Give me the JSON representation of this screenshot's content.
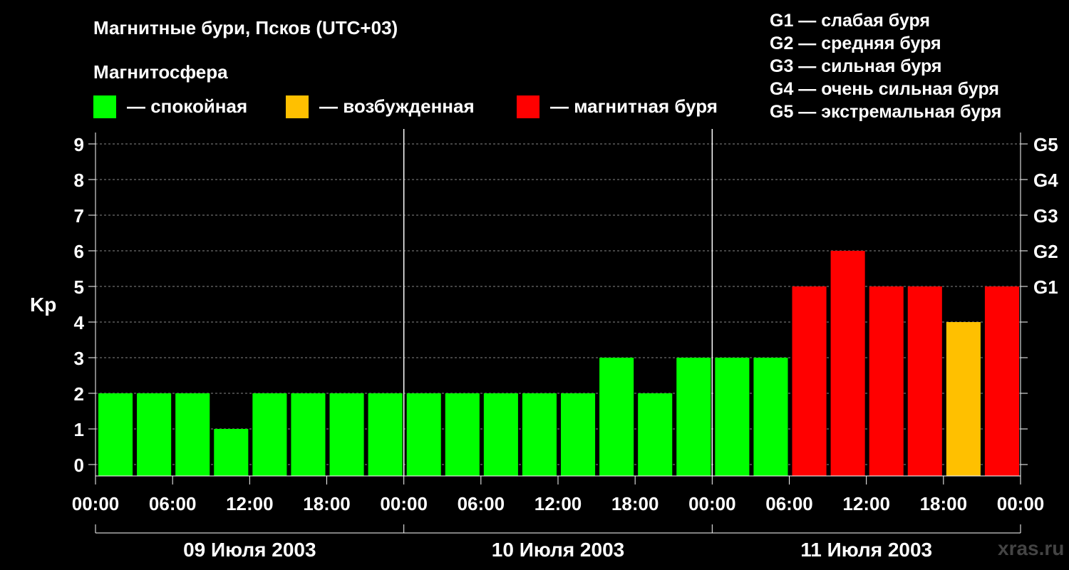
{
  "header": {
    "title": "Магнитные бури, Псков (UTC+03)",
    "subtitle": "Магнитосфера"
  },
  "legend": {
    "items": [
      {
        "label": "— спокойная",
        "color": "#00ff00"
      },
      {
        "label": "— возбужденная",
        "color": "#ffc000"
      },
      {
        "label": "— магнитная буря",
        "color": "#ff0000"
      }
    ]
  },
  "g_levels": [
    "G1 — слабая буря",
    "G2 — средняя буря",
    "G3 — сильная буря",
    "G4 — очень сильная буря",
    "G5 — экстремальная буря"
  ],
  "watermark": "xras.ru",
  "chart_data": {
    "type": "bar",
    "ylabel": "Kp",
    "ylim": [
      0,
      9
    ],
    "y_ticks": [
      "0",
      "1",
      "2",
      "3",
      "4",
      "5",
      "6",
      "7",
      "8",
      "9"
    ],
    "right_ticks": [
      {
        "value": 5,
        "label": "G1"
      },
      {
        "value": 6,
        "label": "G2"
      },
      {
        "value": 7,
        "label": "G3"
      },
      {
        "value": 8,
        "label": "G4"
      },
      {
        "value": 9,
        "label": "G5"
      }
    ],
    "x_tick_labels": [
      "00:00",
      "06:00",
      "12:00",
      "18:00",
      "00:00",
      "06:00",
      "12:00",
      "18:00",
      "00:00",
      "06:00",
      "12:00",
      "18:00",
      "00:00"
    ],
    "days": [
      "09 Июля 2003",
      "10 Июля 2003",
      "11 Июля 2003"
    ],
    "colors": {
      "quiet": "#00ff00",
      "active": "#ffc000",
      "storm": "#ff0000"
    },
    "grid": "dashed horizontal",
    "values": [
      2,
      2,
      2,
      1,
      2,
      2,
      2,
      2,
      2,
      2,
      2,
      2,
      2,
      3,
      2,
      3,
      3,
      3,
      5,
      6,
      5,
      5,
      4,
      5
    ]
  }
}
